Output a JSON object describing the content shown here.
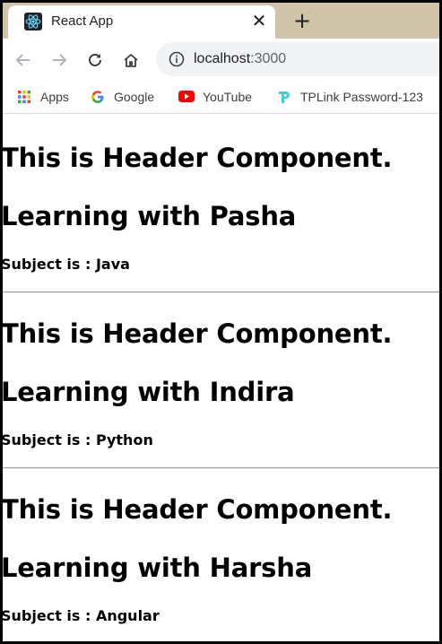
{
  "browser": {
    "tab": {
      "title": "React App",
      "close_glyph": "✕"
    },
    "new_tab_glyph": "+",
    "address": {
      "host": "localhost",
      "port": ":3000"
    },
    "bookmarks": [
      {
        "label": "Apps",
        "icon": "apps-grid-icon"
      },
      {
        "label": "Google",
        "icon": "google-icon"
      },
      {
        "label": "YouTube",
        "icon": "youtube-icon"
      },
      {
        "label": "TPLink Password-123",
        "icon": "tplink-icon"
      }
    ]
  },
  "page": {
    "components": [
      {
        "header": "This is Header Component.",
        "teacher": "Learning with Pasha",
        "subject": "Subject is : Java"
      },
      {
        "header": "This is Header Component.",
        "teacher": "Learning with Indira",
        "subject": "Subject is : Python"
      },
      {
        "header": "This is Header Component.",
        "teacher": "Learning with Harsha",
        "subject": "Subject is : Angular"
      }
    ]
  },
  "colors": {
    "tabstrip": "#cfc3a8",
    "omnibox": "#f1f3f4",
    "youtube_red": "#ff0000",
    "tplink_teal": "#4acbd6",
    "react_cyan": "#61dafb"
  }
}
